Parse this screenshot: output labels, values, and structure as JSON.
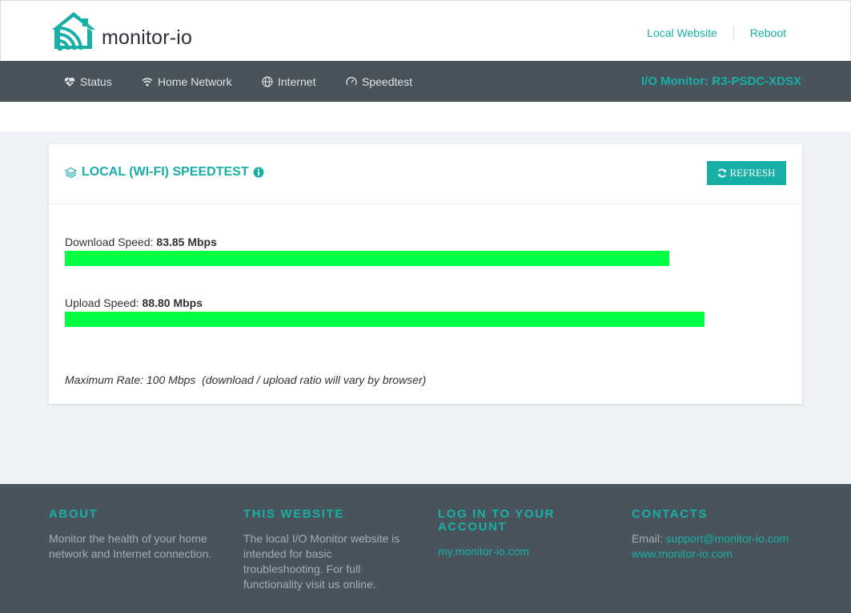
{
  "header": {
    "logo_text": "monitor-io",
    "links": {
      "local_website": "Local Website",
      "reboot": "Reboot"
    }
  },
  "nav": {
    "items": [
      {
        "label": "Status",
        "icon": "heartbeat-icon"
      },
      {
        "label": "Home Network",
        "icon": "wifi-icon"
      },
      {
        "label": "Internet",
        "icon": "globe-icon"
      },
      {
        "label": "Speedtest",
        "icon": "speedometer-icon"
      }
    ],
    "device_title": "I/O Monitor: R3-PSDC-XDSX"
  },
  "card": {
    "title": "LOCAL (WI-FI) SPEEDTEST",
    "refresh_label": "REFRESH",
    "download": {
      "label": "Download Speed:",
      "value": "83.85 Mbps",
      "fraction": 0.8385
    },
    "upload": {
      "label": "Upload Speed:",
      "value": "88.80 Mbps",
      "fraction": 0.888
    },
    "note": "Maximum Rate: 100 Mbps  (download / upload ratio will vary by browser)"
  },
  "footer": {
    "about": {
      "heading": "ABOUT",
      "text": "Monitor the health of your home network and Internet connection."
    },
    "website": {
      "heading": "THIS WEBSITE",
      "text": "The local I/O Monitor website is intended for basic troubleshooting. For full functionality visit us online."
    },
    "account": {
      "heading": "LOG IN TO YOUR ACCOUNT",
      "link": "my.monitor-io.com"
    },
    "contacts": {
      "heading": "CONTACTS",
      "email_label": "Email:",
      "email": "support@monitor-io.com",
      "site": "www.monitor-io.com"
    }
  },
  "colors": {
    "accent": "#18b0a6",
    "nav_bg": "#48535b",
    "bar": "#00ff41",
    "page_bg": "#eef2f6"
  }
}
